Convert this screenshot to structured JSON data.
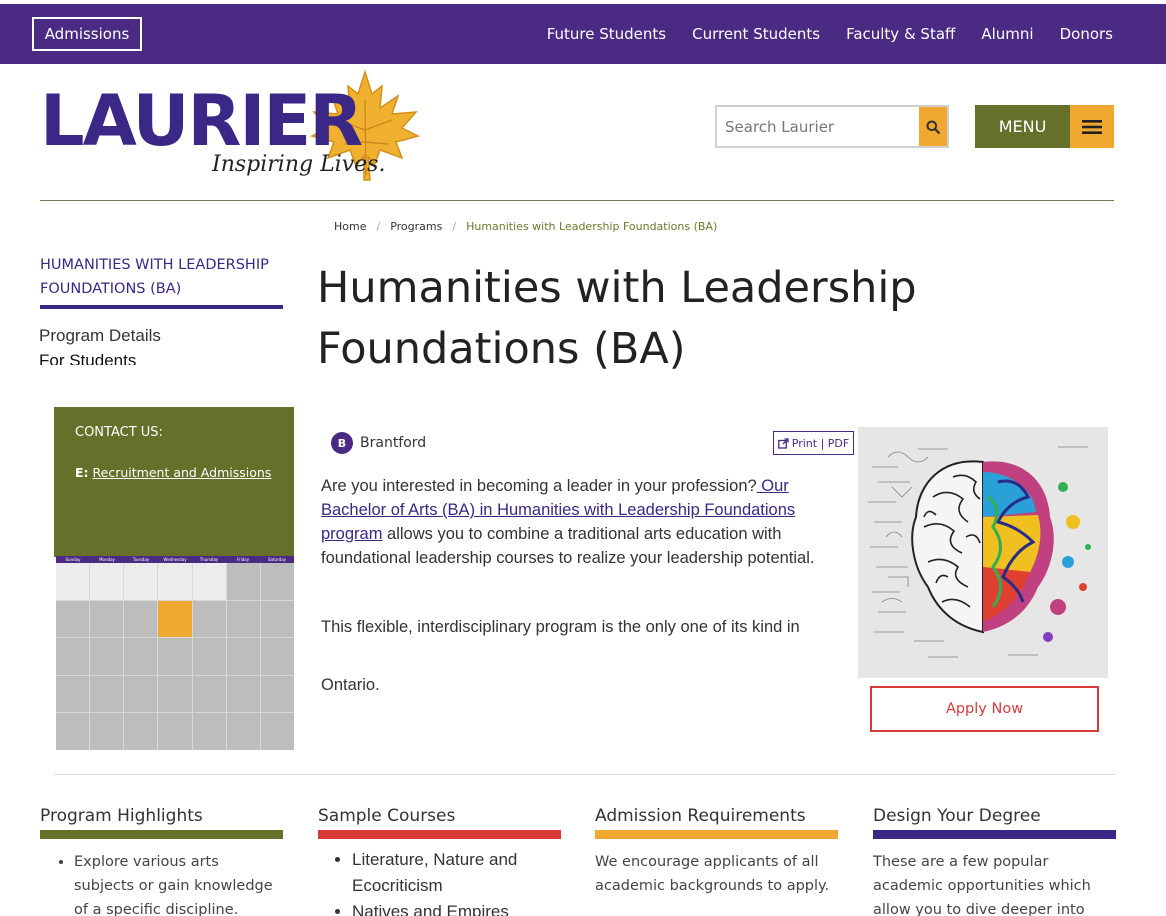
{
  "colors": {
    "purple": "#4a2a82",
    "olive": "#66702a",
    "gold": "#f0a830",
    "red": "#d83a3a"
  },
  "topbar": {
    "admissions_label": "Admissions",
    "nav": [
      "Future Students",
      "Current Students",
      "Faculty & Staff",
      "Alumni",
      "Donors"
    ]
  },
  "logo": {
    "name": "LAURIER",
    "tagline": "Inspiring Lives."
  },
  "search": {
    "placeholder": "Search Laurier",
    "icon": "search-icon"
  },
  "menu": {
    "label": "MENU",
    "icon": "hamburger-icon"
  },
  "breadcrumb": {
    "home": "Home",
    "programs": "Programs",
    "current": "Humanities with Leadership Foundations (BA)"
  },
  "sidebar": {
    "title": "HUMANITIES WITH LEADERSHIP FOUNDATIONS (BA)",
    "links": [
      "Program Details",
      "For Students"
    ]
  },
  "page": {
    "title": "Humanities with Leadership Foundations (BA)"
  },
  "contact": {
    "heading": "CONTACT US:",
    "email_prefix": "E:",
    "email_link": "Recruitment and Admissions"
  },
  "calendar": {
    "days": [
      "Sunday",
      "Monday",
      "Tuesday",
      "Wednesday",
      "Thursday",
      "Friday",
      "Saturday"
    ]
  },
  "campus": {
    "badge": "B",
    "name": "Brantford"
  },
  "print": {
    "label": "Print | PDF",
    "icon": "external-link-icon"
  },
  "intro": {
    "before": "Are you interested in becoming a leader in your profession?",
    "link": " Our Bachelor of Arts (BA) in Humanities with Leadership Foundations program",
    "after": " allows you to combine a traditional arts education with foundational leadership courses to realize your leadership potential."
  },
  "paragraph2": "This flexible, interdisciplinary program is the only one of its kind in",
  "paragraph3": "Ontario.",
  "apply": {
    "label": "Apply Now"
  },
  "columns": {
    "highlights": {
      "title": "Program Highlights",
      "items": [
        "Explore various arts subjects or gain knowledge of a specific discipline."
      ]
    },
    "courses": {
      "title": "Sample Courses",
      "items": [
        "Literature, Nature and Ecocriticism",
        "Natives and Empires"
      ]
    },
    "admission": {
      "title": "Admission Requirements",
      "text": "We encourage applicants of all academic backgrounds to apply."
    },
    "design": {
      "title": "Design Your Degree",
      "text": "These are a few popular academic opportunities which allow you to dive deeper into your major area of study"
    }
  }
}
